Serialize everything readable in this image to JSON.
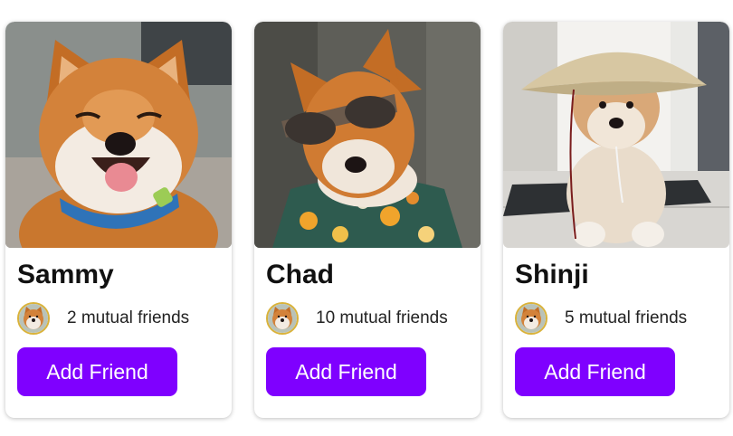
{
  "theme": {
    "accent": "#7f00ff",
    "button_text": "#ffffff"
  },
  "cards": [
    {
      "name": "Sammy",
      "mutual_friends": "2 mutual friends",
      "button_label": "Add Friend",
      "photo": "shiba-inu-smiling-blue-collar"
    },
    {
      "name": "Chad",
      "mutual_friends": "10 mutual friends",
      "button_label": "Add Friend",
      "photo": "shiba-inu-sunglasses-floral-shirt"
    },
    {
      "name": "Shinji",
      "mutual_friends": "5 mutual friends",
      "button_label": "Add Friend",
      "photo": "shiba-inu-straw-hat"
    }
  ]
}
